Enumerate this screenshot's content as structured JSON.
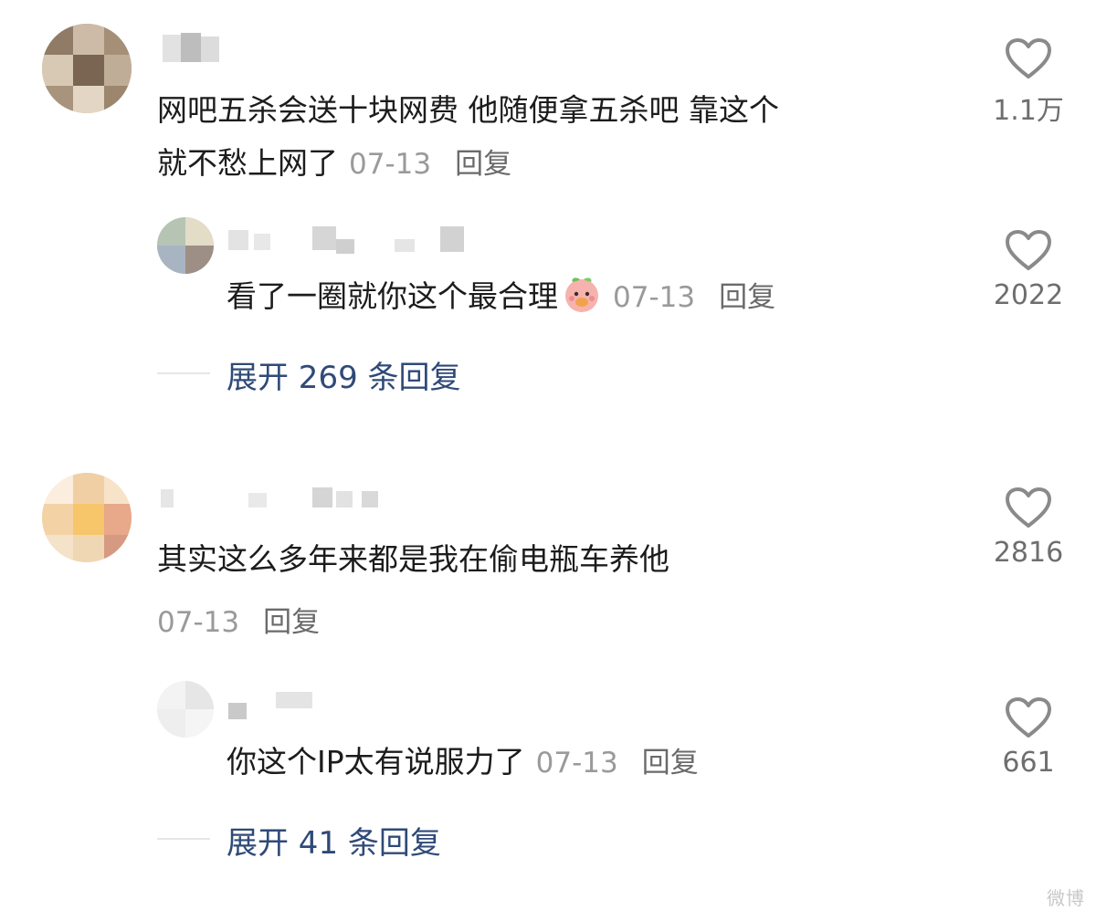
{
  "comments": [
    {
      "text_line1": "网吧五杀会送十块网费 他随便拿五杀吧 靠这个",
      "text_line2": "就不愁上网了",
      "date": "07-13",
      "reply_label": "回复",
      "likes": "1.1万",
      "reply": {
        "text": "看了一圈就你这个最合理",
        "date": "07-13",
        "reply_label": "回复",
        "likes": "2022"
      },
      "expand_label": "展开 269 条回复"
    },
    {
      "text": "其实这么多年来都是我在偷电瓶车养他",
      "date": "07-13",
      "reply_label": "回复",
      "likes": "2816",
      "reply": {
        "text": "你这个IP太有说服力了",
        "date": "07-13",
        "reply_label": "回复",
        "likes": "661"
      },
      "expand_label": "展开 41 条回复"
    }
  ],
  "icons": {
    "like": "heart-outline-icon",
    "emoji": "peach-emoji-icon"
  },
  "colors": {
    "expand_link": "#2f4a78",
    "meta": "#9a9a9a",
    "heart_stroke": "#8a8a8a"
  },
  "watermark": "微博"
}
